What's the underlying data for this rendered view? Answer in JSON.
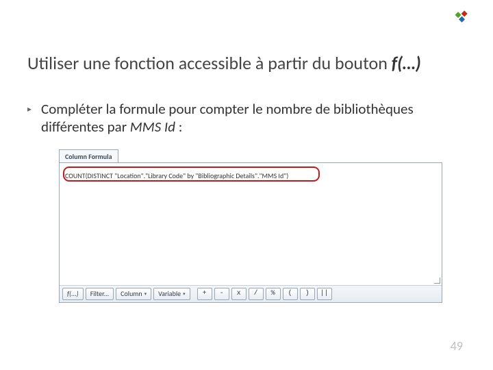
{
  "logo": {
    "name": "brand-logo"
  },
  "title": {
    "prefix": "Utiliser une fonction accessible à partir du bouton ",
    "emph": "f(…)"
  },
  "bullet": {
    "marker": "▸",
    "text_prefix": "Compléter la formule pour compter le nombre de bibliothèques différentes par ",
    "emph": "MMS Id",
    "suffix": " :"
  },
  "panel": {
    "tab_label": "Column Formula",
    "formula": "COUNT(DISTINCT \"Location\".\"Library Code\" by \"Bibliographic Details\".\"MMS Id\")"
  },
  "toolbar": {
    "fn": "f(...)",
    "filter": "Filter...",
    "column": "Column",
    "variable": "Variable",
    "ops": [
      "+",
      "-",
      "x",
      "/",
      "%",
      "(",
      ")",
      "||"
    ]
  },
  "page_number": "49"
}
